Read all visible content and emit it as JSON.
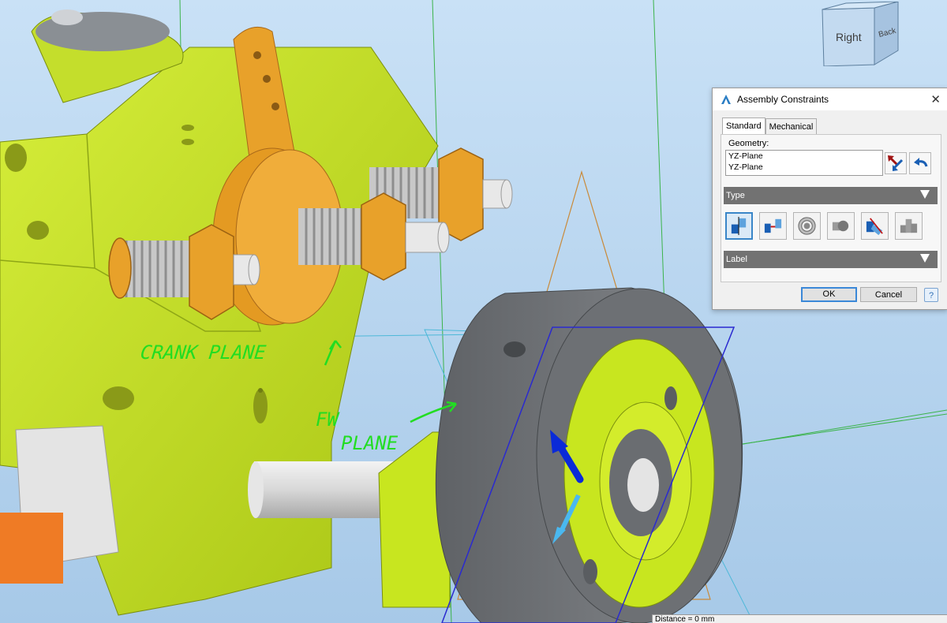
{
  "viewcube": {
    "front_label": "Right",
    "side_label": "Back"
  },
  "dialog": {
    "title": "Assembly Constraints",
    "tabs": [
      {
        "label": "Standard"
      },
      {
        "label": "Mechanical"
      }
    ],
    "geometry_label": "Geometry:",
    "geometry_items": [
      "YZ-Plane",
      "YZ-Plane"
    ],
    "type_section": "Type",
    "label_section": "Label",
    "type_icons": [
      "planar-icon",
      "offset-planar-icon",
      "concentric-icon",
      "point-icon",
      "angle-icon",
      "distance-icon"
    ],
    "ok_label": "OK",
    "cancel_label": "Cancel",
    "help_label": "?"
  },
  "annotations": {
    "crank_plane": "CRANK PLANE",
    "fw_plane_line1": "FW",
    "fw_plane_line2": "PLANE"
  },
  "status": {
    "distance": "Distance = 0 mm"
  },
  "colors": {
    "background": "#b9d6ef",
    "part_green": "#c8e61f",
    "part_orange": "#e8a12a",
    "flywheel_gray": "#6f7276",
    "annotation_green": "#22dd22",
    "accent_blue": "#3a86c8"
  }
}
